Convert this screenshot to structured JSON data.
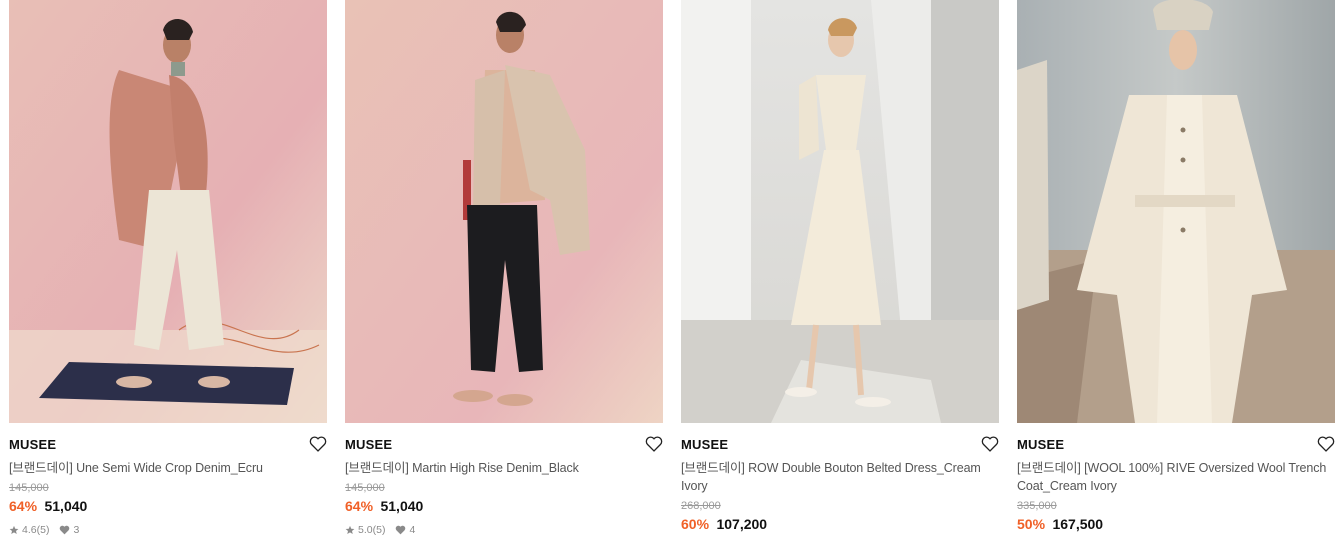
{
  "products": [
    {
      "brand": "MUSEE",
      "name": "[브랜드데이] Une Semi Wide Crop Denim_Ecru",
      "original_price": "145,000",
      "discount": "64%",
      "price": "51,040",
      "rating": "4.6",
      "review_count": "(5)",
      "likes": "3"
    },
    {
      "brand": "MUSEE",
      "name": "[브랜드데이] Martin High Rise Denim_Black",
      "original_price": "145,000",
      "discount": "64%",
      "price": "51,040",
      "rating": "5.0",
      "review_count": "(5)",
      "likes": "4"
    },
    {
      "brand": "MUSEE",
      "name": "[브랜드데이] ROW Double Bouton Belted Dress_Cream Ivory",
      "original_price": "268,000",
      "discount": "60%",
      "price": "107,200"
    },
    {
      "brand": "MUSEE",
      "name": "[브랜드데이] [WOOL 100%] RIVE Oversized Wool Trench Coat_Cream Ivory",
      "original_price": "335,000",
      "discount": "50%",
      "price": "167,500"
    }
  ],
  "icons": {
    "wishlist": "heart-outline-icon",
    "rating": "star-icon",
    "likes": "heart-filled-icon"
  },
  "colors": {
    "discount": "#f06027",
    "price": "#111111",
    "original_price": "#9a9a9a"
  }
}
